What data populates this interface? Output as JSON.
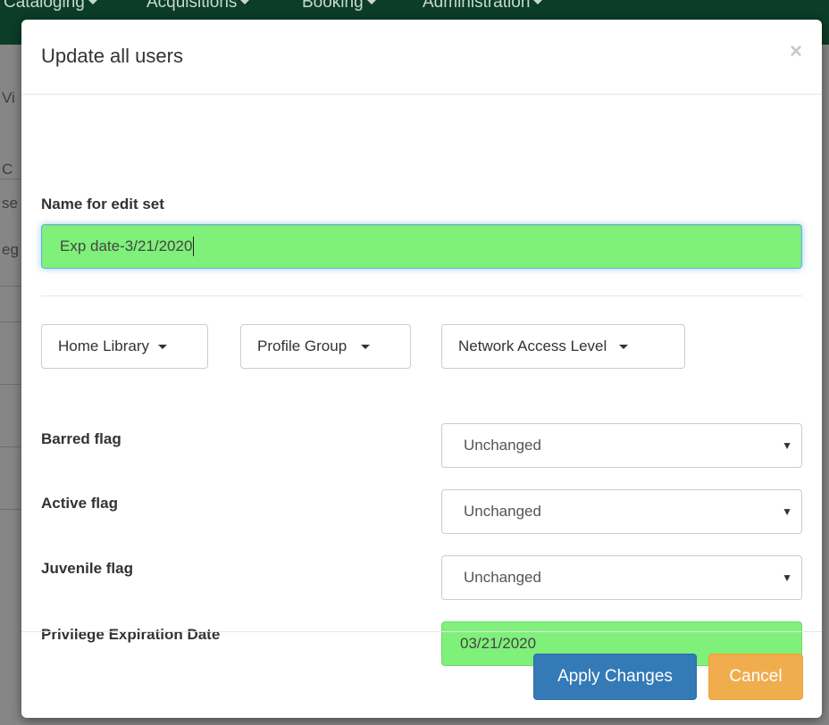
{
  "background": {
    "nav_items": [
      "Cataloging",
      "Acquisitions",
      "Booking",
      "Administration"
    ],
    "fragments": [
      "Vi",
      "C",
      "se",
      "eg"
    ]
  },
  "modal": {
    "title": "Update all users",
    "close_label": "×",
    "name_label": "Name for edit set",
    "name_value": "Exp date-3/21/2020",
    "dropdowns": {
      "home_library": "Home Library",
      "profile_group": "Profile Group",
      "network_access": "Network Access Level"
    },
    "flags": {
      "barred_label": "Barred flag",
      "barred_value": "Unchanged",
      "active_label": "Active flag",
      "active_value": "Unchanged",
      "juvenile_label": "Juvenile flag",
      "juvenile_value": "Unchanged"
    },
    "privilege_label": "Privilege Expiration Date",
    "privilege_value": "03/21/2020",
    "apply_label": "Apply Changes",
    "cancel_label": "Cancel",
    "select_arrow": "▼"
  },
  "colors": {
    "changed_field": "#7ff07a",
    "primary": "#337ab7",
    "warning": "#f0ad4e",
    "navbar": "#0b3d28"
  },
  "icons": [
    "caret-down-icon",
    "close-icon",
    "select-arrow-icon"
  ]
}
